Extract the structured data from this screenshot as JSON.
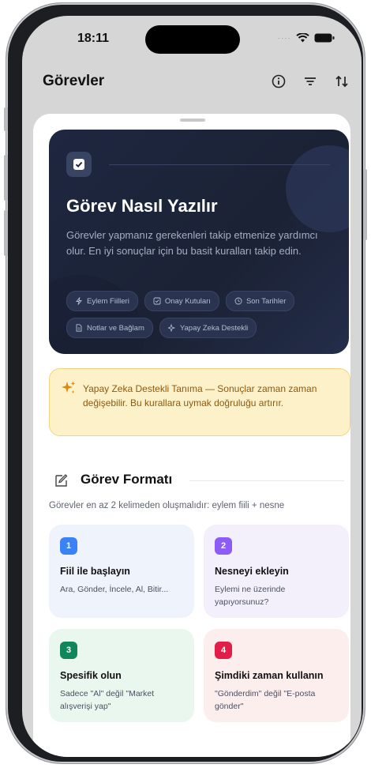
{
  "status": {
    "time": "18:11"
  },
  "nav": {
    "title": "Görevler",
    "info_icon": "info-icon",
    "filter_icon": "filter-icon",
    "sort_icon": "sort-icon"
  },
  "hero": {
    "title": "Görev Nasıl Yazılır",
    "description": "Görevler yapmanız gerekenleri takip etmenize yardımcı olur. En iyi sonuçlar için bu basit kuralları takip edin.",
    "chips": [
      {
        "icon": "bolt-icon",
        "label": "Eylem Fiilleri"
      },
      {
        "icon": "checkbox-icon",
        "label": "Onay Kutuları"
      },
      {
        "icon": "clock-icon",
        "label": "Son Tarihler"
      },
      {
        "icon": "document-icon",
        "label": "Notlar ve Bağlam"
      },
      {
        "icon": "sparkles-icon",
        "label": "Yapay Zeka Destekli"
      }
    ]
  },
  "warning": {
    "text": "Yapay Zeka Destekli Tanıma — Sonuçlar zaman zaman değişebilir. Bu kurallara uymak doğruluğu artırır."
  },
  "format": {
    "title": "Görev Formatı",
    "subtitle": "Görevler en az 2 kelimeden oluşmalıdır: eylem fiili + nesne",
    "cards": [
      {
        "num": "1",
        "title": "Fiil ile başlayın",
        "desc": "Ara, Gönder, İncele, Al, Bitir...",
        "color": "#3b82f6",
        "bg": "#eef3fc"
      },
      {
        "num": "2",
        "title": "Nesneyi ekleyin",
        "desc": "Eylemi ne üzerinde yapıyorsunuz?",
        "color": "#8b5cf6",
        "bg": "#f3f0fc"
      },
      {
        "num": "3",
        "title": "Spesifik olun",
        "desc": "Sadece \"Al\" değil \"Market alışverişi yap\"",
        "color": "#10875a",
        "bg": "#eaf7ef"
      },
      {
        "num": "4",
        "title": "Şimdiki zaman kullanın",
        "desc": "\"Gönderdim\" değil \"E-posta gönder\"",
        "color": "#e11d48",
        "bg": "#fdeeee"
      }
    ]
  }
}
